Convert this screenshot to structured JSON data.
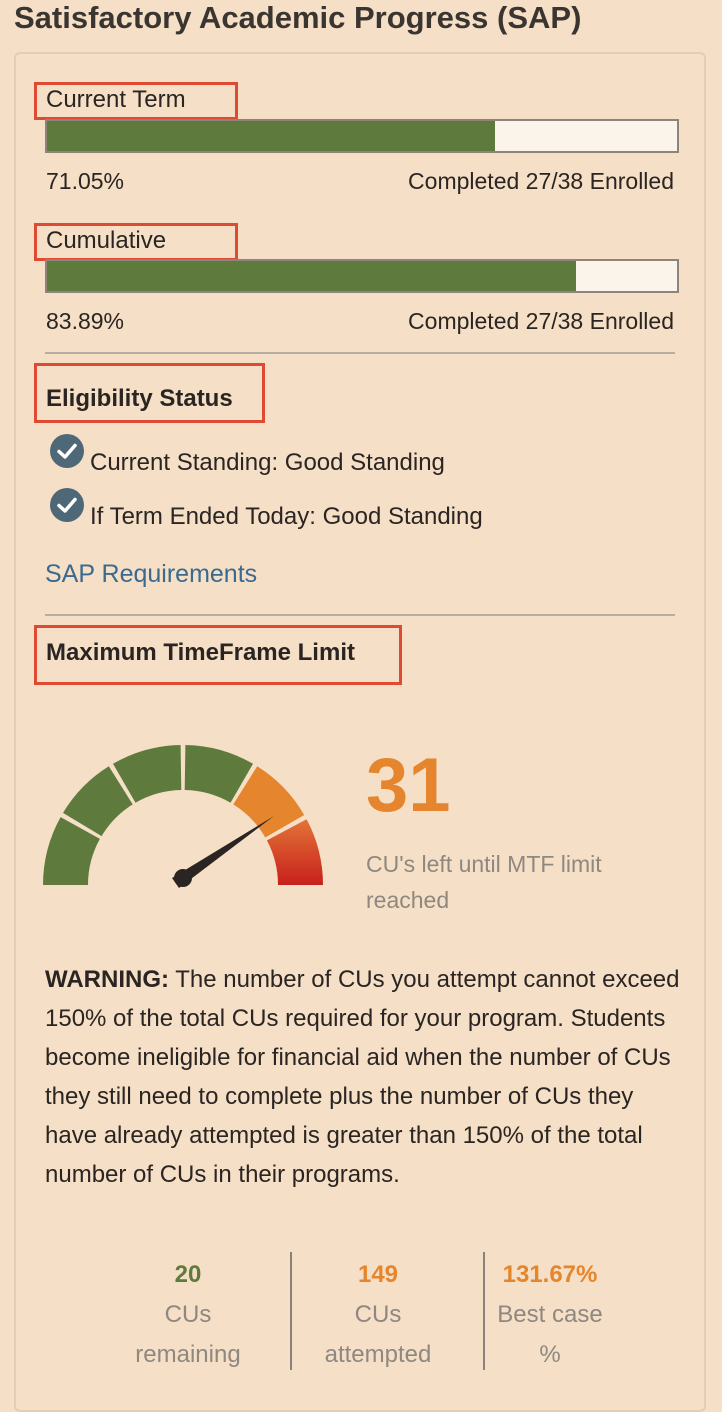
{
  "title": "Satisfactory Academic Progress (SAP)",
  "current_term": {
    "label": "Current Term",
    "percent_text": "71.05%",
    "progress": 0.7105,
    "completed_text": "Completed 27/38 Enrolled"
  },
  "cumulative": {
    "label": "Cumulative",
    "percent_text": "83.89%",
    "progress": 0.8389,
    "completed_text": "Completed 27/38 Enrolled"
  },
  "eligibility": {
    "heading": "Eligibility Status",
    "items": [
      {
        "text": "Current Standing: Good Standing",
        "icon": "check-circle-icon"
      },
      {
        "text": "If Term Ended Today: Good Standing",
        "icon": "check-circle-icon"
      }
    ],
    "link": "SAP Requirements"
  },
  "mtf": {
    "heading": "Maximum TimeFrame Limit",
    "value": "31",
    "caption": "CU's left until MTF limit reached",
    "warning_prefix": "WARNING:",
    "warning_body": "The number of CUs you attempt cannot exceed 150% of the total CUs required for your program. Students become ineligible for financial aid when the number of CUs they still need to complete plus the number of CUs they have already attempted is greater than 150% of the total number of CUs in their programs.",
    "stats": [
      {
        "value": "20",
        "line1": "CUs",
        "line2": "remaining",
        "color": "#5e7b3d"
      },
      {
        "value": "149",
        "line1": "CUs",
        "line2": "attempted",
        "color": "#e5852d"
      },
      {
        "value": "131.67%",
        "line1": "Best case",
        "line2": "%",
        "color": "#e5852d"
      }
    ]
  },
  "colors": {
    "bar_fill": "#5e7b3d",
    "accent_orange": "#e5852d",
    "link_blue": "#3b6a8e",
    "highlight_red": "#df4a33",
    "check_icon": "#4e6877"
  }
}
